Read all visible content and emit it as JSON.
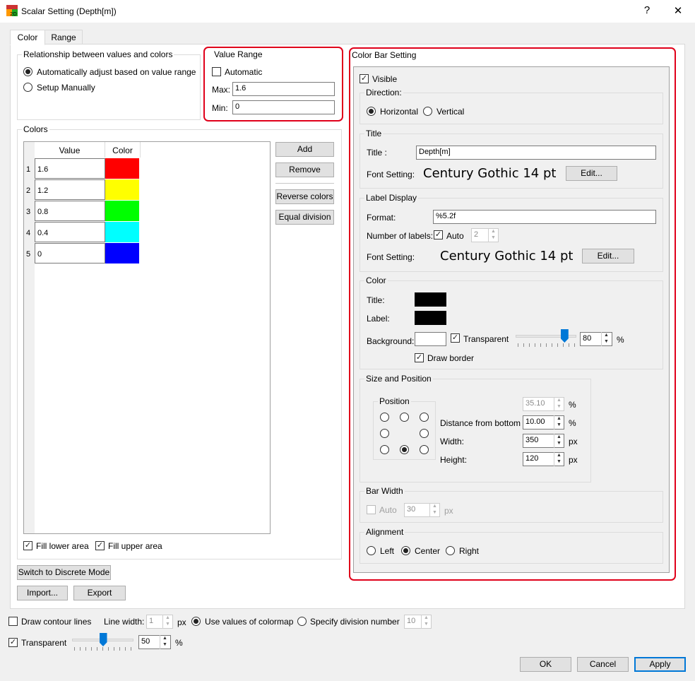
{
  "window": {
    "title": "Scalar Setting (Depth[m])",
    "help": "?",
    "close": "✕"
  },
  "tabs": [
    "Color",
    "Range"
  ],
  "relationship": {
    "legend": "Relationship between values and colors",
    "auto_label": "Automatically adjust based on value range",
    "manual_label": "Setup Manually",
    "selected": "auto"
  },
  "value_range": {
    "legend": "Value Range",
    "automatic_label": "Automatic",
    "automatic": false,
    "max_label": "Max:",
    "max": "1.6",
    "min_label": "Min:",
    "min": "0"
  },
  "colors": {
    "legend": "Colors",
    "headers": [
      "Value",
      "Color"
    ],
    "rows": [
      {
        "index": "1",
        "value": "1.6",
        "color": "#ff0000"
      },
      {
        "index": "2",
        "value": "1.2",
        "color": "#ffff00"
      },
      {
        "index": "3",
        "value": "0.8",
        "color": "#00ff00"
      },
      {
        "index": "4",
        "value": "0.4",
        "color": "#00ffff"
      },
      {
        "index": "5",
        "value": "0",
        "color": "#0000ff"
      }
    ],
    "add": "Add",
    "remove": "Remove",
    "reverse": "Reverse colors",
    "equal": "Equal division",
    "fill_lower": "Fill lower area",
    "fill_upper": "Fill upper area",
    "fill_lower_checked": true,
    "fill_upper_checked": true
  },
  "switch_mode": "Switch to Discrete Mode",
  "import": "Import...",
  "export": "Export",
  "colorbar": {
    "legend": "Color Bar Setting",
    "visible_label": "Visible",
    "visible": true,
    "direction": {
      "legend": "Direction:",
      "horizontal": "Horizontal",
      "vertical": "Vertical",
      "selected": "horizontal"
    },
    "title": {
      "legend": "Title",
      "title_label": "Title :",
      "title_value": "Depth[m]",
      "font_label": "Font Setting:",
      "font_value": "Century Gothic 14 pt",
      "edit": "Edit..."
    },
    "label_display": {
      "legend": "Label Display",
      "format_label": "Format:",
      "format_value": "%5.2f",
      "num_label": "Number of labels:",
      "auto_label": "Auto",
      "auto": true,
      "num_value": "2",
      "font_label": "Font Setting:",
      "font_value": "Century Gothic 14 pt",
      "edit": "Edit..."
    },
    "color": {
      "legend": "Color",
      "title_label": "Title:",
      "label_label": "Label:",
      "background_label": "Background:",
      "title_color": "#000000",
      "label_color": "#000000",
      "background_color": "#ffffff",
      "transparent_label": "Transparent",
      "transparent": true,
      "opacity": 80,
      "opacity_value": "80",
      "pct": "%",
      "draw_border_label": "Draw border",
      "draw_border": true
    },
    "size_position": {
      "legend": "Size and Position",
      "position_legend": "Position",
      "selected_position": "bottom-center",
      "x_value": "35.10",
      "x_unit": "%",
      "distance_label": "Distance from bottom",
      "distance_value": "10.00",
      "distance_unit": "%",
      "width_label": "Width:",
      "width_value": "350",
      "width_unit": "px",
      "height_label": "Height:",
      "height_value": "120",
      "height_unit": "px"
    },
    "bar_width": {
      "legend": "Bar Width",
      "auto_label": "Auto",
      "value": "30",
      "unit": "px"
    },
    "alignment": {
      "legend": "Alignment",
      "left": "Left",
      "center": "Center",
      "right": "Right",
      "selected": "center"
    }
  },
  "bottom": {
    "contour_label": "Draw contour lines",
    "contour": false,
    "line_width_label": "Line width:",
    "line_width": "1",
    "line_width_unit": "px",
    "use_colormap_label": "Use values of colormap",
    "specify_label": "Specify division number",
    "division": "10",
    "selected": "colormap",
    "transparent_label": "Transparent",
    "transparent": true,
    "opacity": 50,
    "opacity_value": "50",
    "pct": "%"
  },
  "buttons": {
    "ok": "OK",
    "cancel": "Cancel",
    "apply": "Apply"
  }
}
